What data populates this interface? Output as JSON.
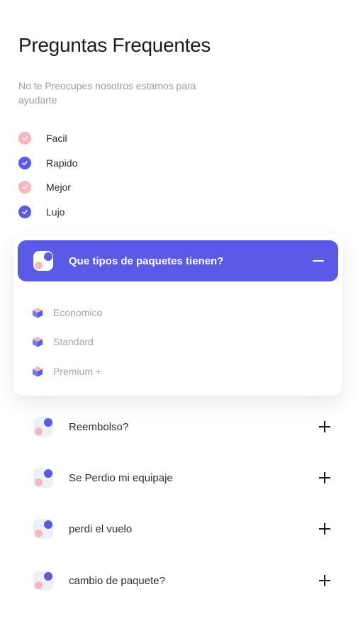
{
  "header": {
    "title": "Preguntas Frequentes",
    "subtitle": "No te Preocupes nosotros estamos para ayudarte"
  },
  "features": [
    {
      "label": "Facil",
      "check_color": "#f8b7c0"
    },
    {
      "label": "Rapido",
      "check_color": "#5a5ae6"
    },
    {
      "label": "Mejor",
      "check_color": "#f8b7c0"
    },
    {
      "label": "Lujo",
      "check_color": "#5a5ae6"
    }
  ],
  "faq": {
    "open_item": {
      "question": "Que tipos de paquetes tienen?",
      "expanded": true,
      "answers": [
        "Economico",
        "Standard",
        "Premium +"
      ]
    },
    "items": [
      {
        "question": "Reembolso?",
        "expanded": false
      },
      {
        "question": "Se Perdio mi equipaje",
        "expanded": false
      },
      {
        "question": "perdi el vuelo",
        "expanded": false
      },
      {
        "question": "cambio de paquete?",
        "expanded": false
      }
    ]
  },
  "colors": {
    "accent": "#5a5ae6",
    "pink": "#f8b7c0",
    "muted_text": "#9a9ab0"
  },
  "icons": {
    "check": "check-icon",
    "faq": "dots-icon",
    "answer": "cube-icon",
    "collapse": "minus-icon",
    "expand": "plus-icon"
  }
}
